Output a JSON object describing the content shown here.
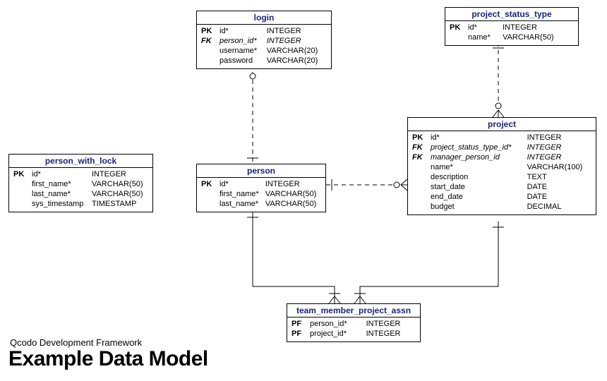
{
  "diagram": {
    "footer_sub": "Qcodo Development Framework",
    "footer_main": "Example Data Model"
  },
  "entities": {
    "login": {
      "title": "login",
      "rows": [
        {
          "key": "PK",
          "name": "id*",
          "type": "INTEGER",
          "fk": false
        },
        {
          "key": "FK",
          "name": "person_id*",
          "type": "INTEGER",
          "fk": true
        },
        {
          "key": "",
          "name": "username*",
          "type": "VARCHAR(20)",
          "fk": false
        },
        {
          "key": "",
          "name": "password",
          "type": "VARCHAR(20)",
          "fk": false
        }
      ]
    },
    "project_status_type": {
      "title": "project_status_type",
      "rows": [
        {
          "key": "PK",
          "name": "id*",
          "type": "INTEGER",
          "fk": false
        },
        {
          "key": "",
          "name": "name*",
          "type": "VARCHAR(50)",
          "fk": false
        }
      ]
    },
    "person_with_lock": {
      "title": "person_with_lock",
      "rows": [
        {
          "key": "PK",
          "name": "id*",
          "type": "INTEGER",
          "fk": false
        },
        {
          "key": "",
          "name": "first_name*",
          "type": "VARCHAR(50)",
          "fk": false
        },
        {
          "key": "",
          "name": "last_name*",
          "type": "VARCHAR(50)",
          "fk": false
        },
        {
          "key": "",
          "name": "sys_timestamp",
          "type": "TIMESTAMP",
          "fk": false
        }
      ]
    },
    "person": {
      "title": "person",
      "rows": [
        {
          "key": "PK",
          "name": "id*",
          "type": "INTEGER",
          "fk": false
        },
        {
          "key": "",
          "name": "first_name*",
          "type": "VARCHAR(50)",
          "fk": false
        },
        {
          "key": "",
          "name": "last_name*",
          "type": "VARCHAR(50)",
          "fk": false
        }
      ]
    },
    "project": {
      "title": "project",
      "rows": [
        {
          "key": "PK",
          "name": "id*",
          "type": "INTEGER",
          "fk": false
        },
        {
          "key": "FK",
          "name": "project_status_type_id*",
          "type": "INTEGER",
          "fk": true
        },
        {
          "key": "FK",
          "name": "manager_person_id",
          "type": "INTEGER",
          "fk": true
        },
        {
          "key": "",
          "name": "name*",
          "type": "VARCHAR(100)",
          "fk": false
        },
        {
          "key": "",
          "name": "description",
          "type": "TEXT",
          "fk": false
        },
        {
          "key": "",
          "name": "start_date",
          "type": "DATE",
          "fk": false
        },
        {
          "key": "",
          "name": "end_date",
          "type": "DATE",
          "fk": false
        },
        {
          "key": "",
          "name": "budget",
          "type": "DECIMAL",
          "fk": false
        }
      ]
    },
    "team_member_project_assn": {
      "title": "team_member_project_assn",
      "rows": [
        {
          "key": "PF",
          "name": "person_id*",
          "type": "INTEGER",
          "fk": false
        },
        {
          "key": "PF",
          "name": "project_id*",
          "type": "INTEGER",
          "fk": false
        }
      ]
    }
  }
}
